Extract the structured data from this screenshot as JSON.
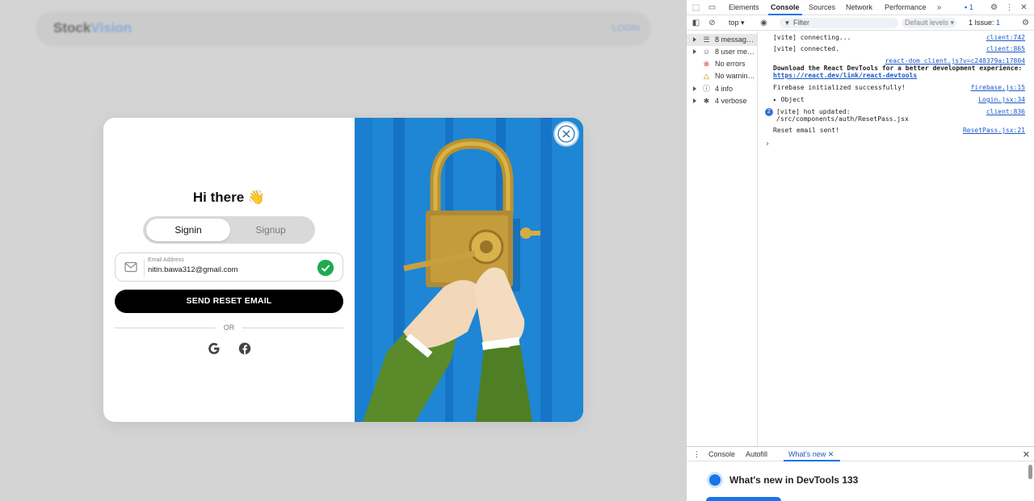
{
  "app": {
    "brand_part1": "Stock",
    "brand_part2": "Vision",
    "nav_login": "LOGIN"
  },
  "modal": {
    "greeting": "Hi there 👋",
    "tabs": [
      {
        "label": "Signin",
        "active": true
      },
      {
        "label": "Signup",
        "active": false
      }
    ],
    "email": {
      "label": "Email Address",
      "value": "nitin.bawa312@gmail.com"
    },
    "send_button": "SEND RESET EMAIL",
    "divider": "OR",
    "social": [
      "google-icon",
      "facebook-icon"
    ]
  },
  "devtools": {
    "tabs": [
      "Elements",
      "Console",
      "Sources",
      "Network",
      "Performance"
    ],
    "active_tab": "Console",
    "message_count_badge": "1",
    "context": "top",
    "filter_placeholder": "Filter",
    "levels": "Default levels",
    "issues": "1 Issue:",
    "issues_count": "1",
    "sidebar": [
      {
        "label": "8 messag…",
        "icon": "list-icon"
      },
      {
        "label": "8 user me…",
        "icon": "user-icon"
      },
      {
        "label": "No errors",
        "icon": "error-icon"
      },
      {
        "label": "No warnin…",
        "icon": "warning-icon"
      },
      {
        "label": "4 info",
        "icon": "info-icon"
      },
      {
        "label": "4 verbose",
        "icon": "bug-icon"
      }
    ],
    "logs": [
      {
        "msg": "[vite] connecting...",
        "src": "client:742"
      },
      {
        "msg": "[vite] connected.",
        "src": "client:865"
      },
      {
        "msg_line1": "Download the React DevTools for a better development experience:",
        "msg_link": "https://react.dev/link/react-devtools",
        "src": "react-dom_client.js?v=c248379a:17804"
      },
      {
        "msg": "Firebase initialized successfully!",
        "src": "firebase.js:15"
      },
      {
        "msg": "Object",
        "src": "Login.jsx:34"
      },
      {
        "msg_line1": "[vite] hot updated:",
        "msg_line2": "/src/components/auth/ResetPass.jsx",
        "badge": "2",
        "src": "client:836"
      },
      {
        "msg": "Reset email sent!",
        "src": "ResetPass.jsx:21"
      }
    ],
    "drawer": {
      "tabs": [
        "Console",
        "Autofill",
        "What's new"
      ],
      "active_tab": "What's new",
      "title": "What's new in DevTools 133"
    }
  }
}
